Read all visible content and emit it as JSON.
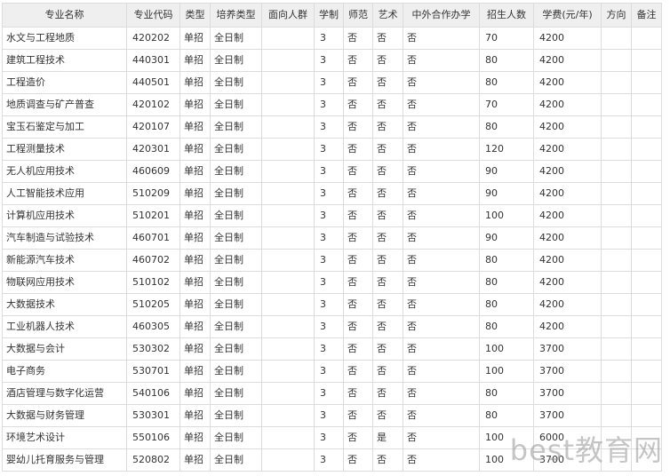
{
  "table": {
    "headers": [
      "专业名称",
      "专业代码",
      "类型",
      "培养类型",
      "面向人群",
      "学制",
      "师范",
      "艺术",
      "中外合作办学",
      "招生人数",
      "学费(元/年)",
      "方向",
      "备注"
    ],
    "rows": [
      [
        "水文与工程地质",
        "420202",
        "单招",
        "全日制",
        "",
        "3",
        "否",
        "否",
        "否",
        "70",
        "4200",
        "",
        ""
      ],
      [
        "建筑工程技术",
        "440301",
        "单招",
        "全日制",
        "",
        "3",
        "否",
        "否",
        "否",
        "80",
        "4200",
        "",
        ""
      ],
      [
        "工程造价",
        "440501",
        "单招",
        "全日制",
        "",
        "3",
        "否",
        "否",
        "否",
        "80",
        "4200",
        "",
        ""
      ],
      [
        "地质调查与矿产普查",
        "420102",
        "单招",
        "全日制",
        "",
        "3",
        "否",
        "否",
        "否",
        "70",
        "4200",
        "",
        ""
      ],
      [
        "宝玉石鉴定与加工",
        "420107",
        "单招",
        "全日制",
        "",
        "3",
        "否",
        "否",
        "否",
        "80",
        "4200",
        "",
        ""
      ],
      [
        "工程测量技术",
        "420301",
        "单招",
        "全日制",
        "",
        "3",
        "否",
        "否",
        "否",
        "120",
        "4200",
        "",
        ""
      ],
      [
        "无人机应用技术",
        "460609",
        "单招",
        "全日制",
        "",
        "3",
        "否",
        "否",
        "否",
        "90",
        "4200",
        "",
        ""
      ],
      [
        "人工智能技术应用",
        "510209",
        "单招",
        "全日制",
        "",
        "3",
        "否",
        "否",
        "否",
        "90",
        "4200",
        "",
        ""
      ],
      [
        "计算机应用技术",
        "510201",
        "单招",
        "全日制",
        "",
        "3",
        "否",
        "否",
        "否",
        "100",
        "4200",
        "",
        ""
      ],
      [
        "汽车制造与试验技术",
        "460701",
        "单招",
        "全日制",
        "",
        "3",
        "否",
        "否",
        "否",
        "90",
        "4200",
        "",
        ""
      ],
      [
        "新能源汽车技术",
        "460702",
        "单招",
        "全日制",
        "",
        "3",
        "否",
        "否",
        "否",
        "80",
        "4200",
        "",
        ""
      ],
      [
        "物联网应用技术",
        "510102",
        "单招",
        "全日制",
        "",
        "3",
        "否",
        "否",
        "否",
        "80",
        "4200",
        "",
        ""
      ],
      [
        "大数据技术",
        "510205",
        "单招",
        "全日制",
        "",
        "3",
        "否",
        "否",
        "否",
        "80",
        "4200",
        "",
        ""
      ],
      [
        "工业机器人技术",
        "460305",
        "单招",
        "全日制",
        "",
        "3",
        "否",
        "否",
        "否",
        "80",
        "4200",
        "",
        ""
      ],
      [
        "大数据与会计",
        "530302",
        "单招",
        "全日制",
        "",
        "3",
        "否",
        "否",
        "否",
        "100",
        "3700",
        "",
        ""
      ],
      [
        "电子商务",
        "530701",
        "单招",
        "全日制",
        "",
        "3",
        "否",
        "否",
        "否",
        "100",
        "3700",
        "",
        ""
      ],
      [
        "酒店管理与数字化运营",
        "540106",
        "单招",
        "全日制",
        "",
        "3",
        "否",
        "否",
        "否",
        "80",
        "3700",
        "",
        ""
      ],
      [
        "大数据与财务管理",
        "530301",
        "单招",
        "全日制",
        "",
        "3",
        "否",
        "否",
        "否",
        "80",
        "3700",
        "",
        ""
      ],
      [
        "环境艺术设计",
        "550106",
        "单招",
        "全日制",
        "",
        "3",
        "否",
        "是",
        "否",
        "100",
        "6000",
        "",
        ""
      ],
      [
        "婴幼儿托育服务与管理",
        "520802",
        "单招",
        "全日制",
        "",
        "3",
        "否",
        "否",
        "否",
        "100",
        "3700",
        "",
        ""
      ]
    ]
  },
  "watermark": "best教育网"
}
